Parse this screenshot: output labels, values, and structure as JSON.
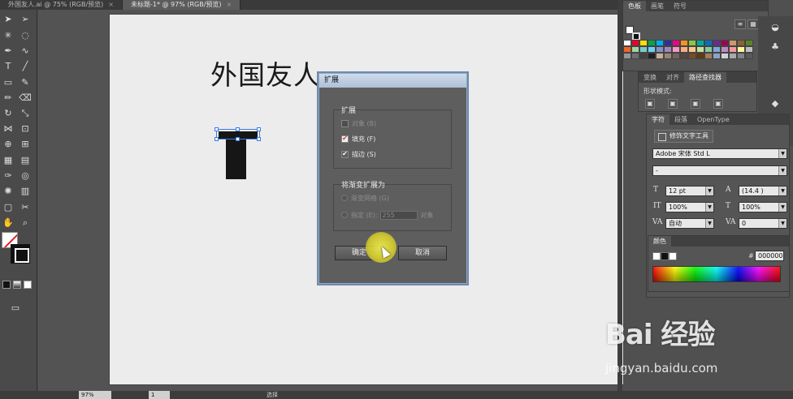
{
  "doc_tabs": [
    {
      "label": "外国友人.ai @ 75% (RGB/预览)",
      "close": "×",
      "active": false
    },
    {
      "label": "未标题-1* @ 97% (RGB/预览)",
      "close": "×",
      "active": true
    }
  ],
  "artboard": {
    "title_text": "外国友人"
  },
  "dialog": {
    "title": "扩展",
    "expand_group": "扩展",
    "opt_object": "对象 (B)",
    "opt_fill": "填充 (F)",
    "opt_stroke": "描边 (S)",
    "gradient_group": "将渐变扩展为",
    "opt_mesh": "渐变网格 (G)",
    "opt_specify": "指定 (E):",
    "specify_value": "255",
    "specify_unit": "对象",
    "ok": "确定",
    "cancel": "取消",
    "checked_fill": "✔",
    "checked_stroke": "✔"
  },
  "swatches_panel": {
    "tabs": [
      "色板",
      "画笔",
      "符号"
    ]
  },
  "pathfinder_panel": {
    "tabs": [
      "变换",
      "对齐",
      "路径查找器"
    ],
    "shape_modes": "形状模式:"
  },
  "character_panel": {
    "tabs": [
      "字符",
      "段落",
      "OpenType"
    ],
    "touch_type": "修饰文字工具",
    "font": "Adobe 宋体 Std L",
    "style": "-",
    "size": "12 pt",
    "leading": "(14.4 )",
    "vscale": "100%",
    "hscale": "100%",
    "kerning": "自动",
    "tracking": "0"
  },
  "color_panel": {
    "title": "颜色",
    "hex_prefix": "#",
    "hex": "000000"
  },
  "statusbar": {
    "zoom": "97%",
    "page": "1",
    "mode": "选择"
  },
  "watermark": {
    "logo": "Bai 经验",
    "url": "jingyan.baidu.com"
  }
}
